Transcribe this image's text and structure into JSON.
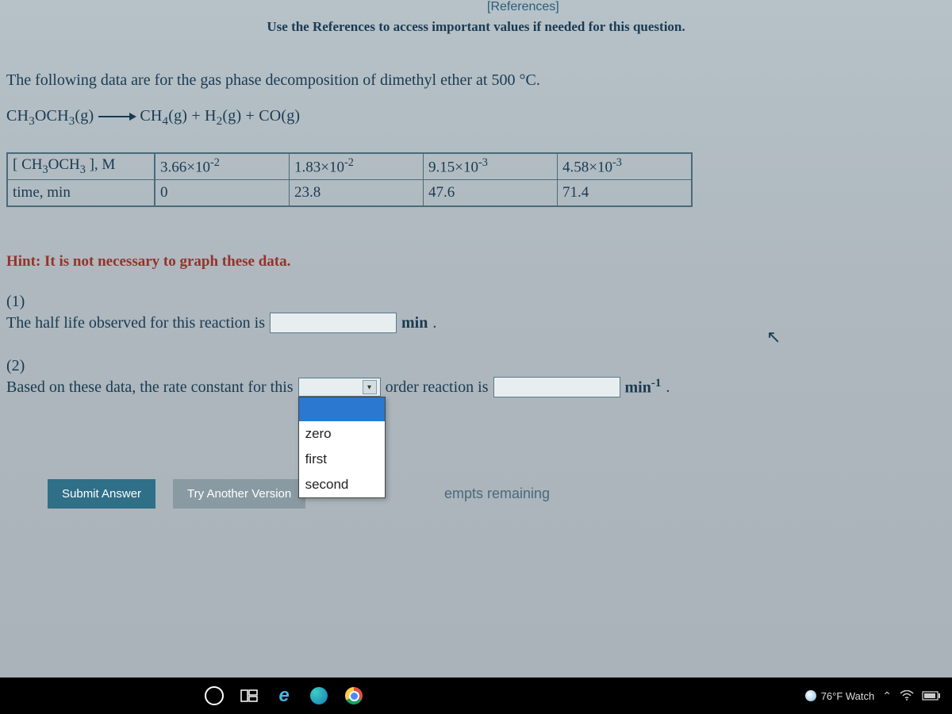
{
  "header": {
    "references_link": "[References]",
    "instruction": "Use the References to access important values if needed for this question."
  },
  "question": {
    "intro": "The following data are for the gas phase decomposition of dimethyl ether at 500 °C.",
    "equation_lhs": "CH3OCH3(g)",
    "equation_rhs": "CH4(g) + H2(g) + CO(g)",
    "table": {
      "row_labels": [
        "[ CH3OCH3 ], M",
        "time, min"
      ],
      "concentrations": [
        "3.66×10-2",
        "1.83×10-2",
        "9.15×10-3",
        "4.58×10-3"
      ],
      "times": [
        "0",
        "23.8",
        "47.6",
        "71.4"
      ]
    },
    "hint": "Hint: It is not necessary to graph these data.",
    "part1": {
      "label": "(1)",
      "text_before": "The half life observed for this reaction is",
      "unit": "min",
      "suffix": "."
    },
    "part2": {
      "label": "(2)",
      "text_before": "Based on these data, the rate constant for this",
      "text_mid": "order reaction is",
      "unit": "min",
      "unit_sup": "-1",
      "suffix": ".",
      "dropdown": {
        "selected": "",
        "options": [
          "",
          "zero",
          "first",
          "second"
        ]
      }
    },
    "buttons": {
      "submit": "Submit Answer",
      "another": "Try Another Version"
    },
    "attempts_remaining": "empts remaining"
  },
  "taskbar": {
    "weather": "76°F  Watch"
  }
}
